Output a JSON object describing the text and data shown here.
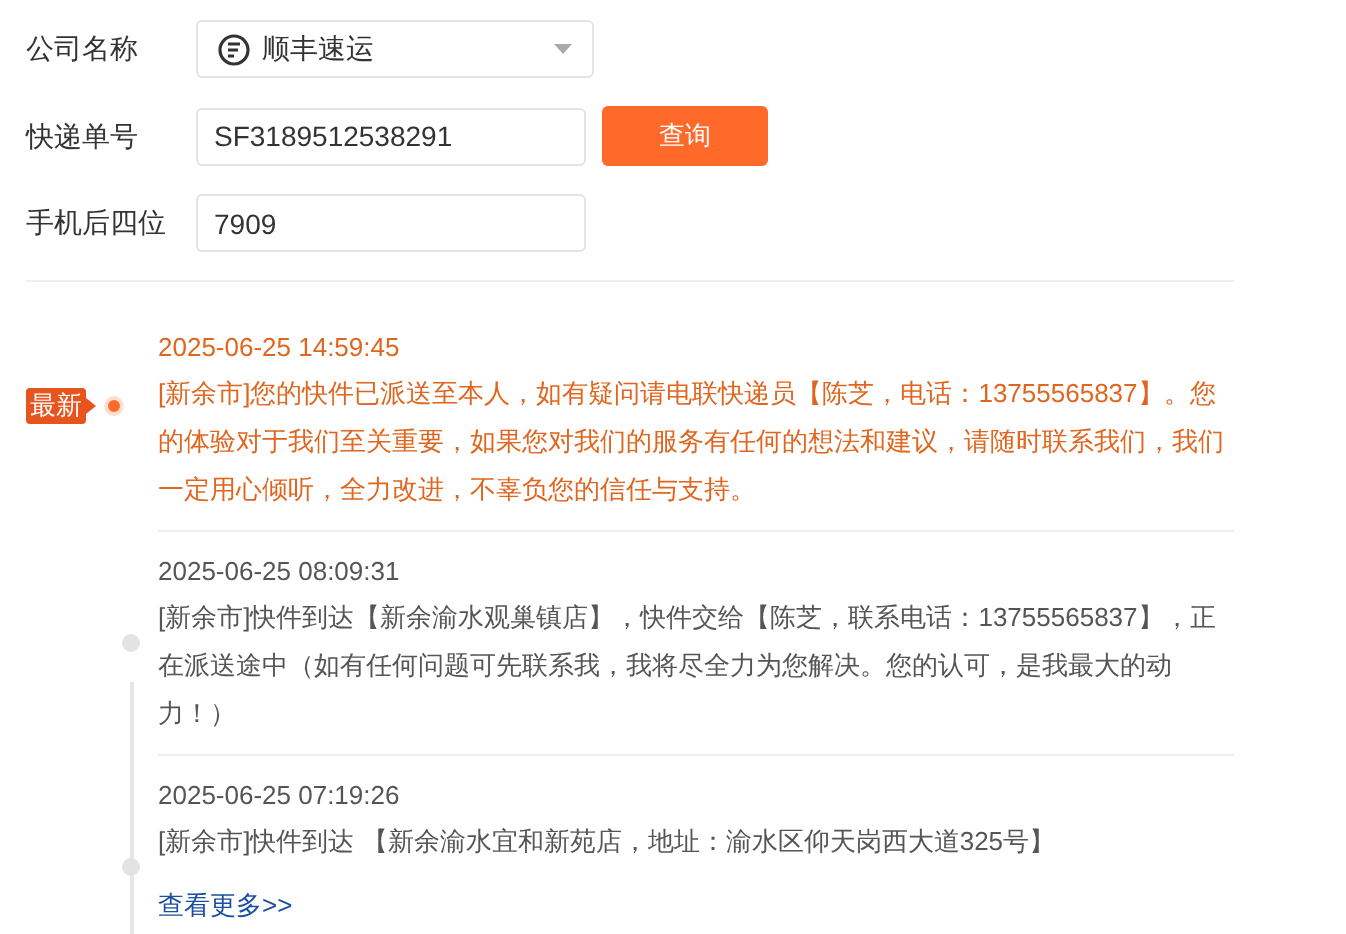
{
  "form": {
    "fields": [
      {
        "kind": "select",
        "label": "公司名称",
        "value": "顺丰速运"
      },
      {
        "kind": "input",
        "label": "快递单号",
        "value": "SF3189512538291"
      },
      {
        "kind": "input",
        "label": "手机后四位",
        "value": "7909"
      }
    ],
    "query_button": "查询"
  },
  "timeline": {
    "latest_badge": "最新",
    "events": [
      {
        "time": "2025-06-25 14:59:45",
        "text": "[新余市]您的快件已派送至本人，如有疑问请电联快递员【陈芝，电话：13755565837】。您的体验对于我们至关重要，如果您对我们的服务有任何的想法和建议，请随时联系我们，我们一定用心倾听，全力改进，不辜负您的信任与支持。",
        "latest": true
      },
      {
        "time": "2025-06-25 08:09:31",
        "text": "[新余市]快件到达【新余渝水观巢镇店】，快件交给【陈芝，联系电话：13755565837】，正在派送途中（如有任何问题可先联系我，我将尽全力为您解决。您的认可，是我最大的动力！）",
        "latest": false
      },
      {
        "time": "2025-06-25 07:19:26",
        "text": "[新余市]快件到达 【新余渝水宜和新苑店，地址：渝水区仰天岗西大道325号】",
        "latest": false
      }
    ],
    "more_link": "查看更多>>"
  }
}
